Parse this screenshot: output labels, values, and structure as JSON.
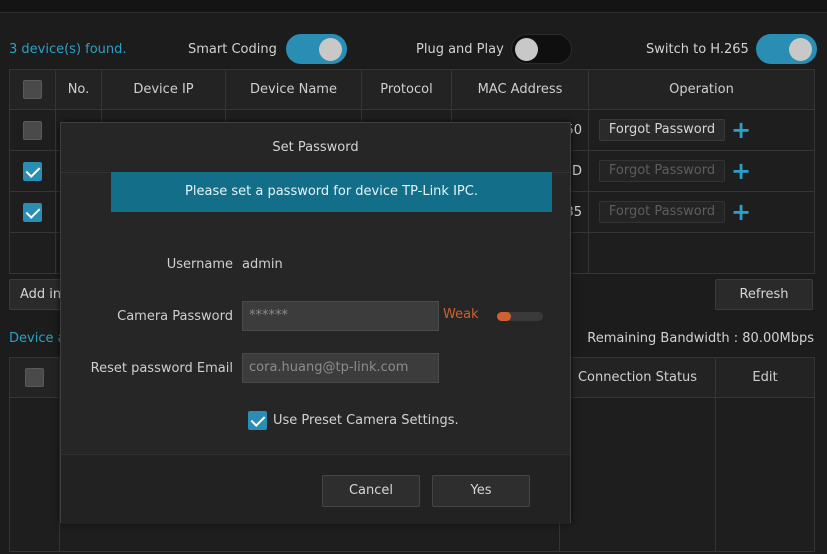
{
  "status": {
    "found_text": "3 device(s) found.",
    "smart_coding": {
      "label": "Smart Coding",
      "on": true
    },
    "plug_and_play": {
      "label": "Plug and Play",
      "on": false
    },
    "switch_h265": {
      "label": "Switch to H.265",
      "on": true
    }
  },
  "device_table": {
    "headers": [
      "No.",
      "Device IP",
      "Device Name",
      "Protocol",
      "MAC Address",
      "Operation"
    ],
    "rows": [
      {
        "checked": false,
        "mac_suffix": "50",
        "operation": "Forgot Password",
        "enabled": true
      },
      {
        "checked": true,
        "mac_suffix": "D",
        "operation": "Forgot Password",
        "enabled": false
      },
      {
        "checked": true,
        "mac_suffix": "35",
        "operation": "Forgot Password",
        "enabled": false
      }
    ]
  },
  "actions": {
    "add_label": "Add in",
    "refresh_label": "Refresh"
  },
  "added_section": {
    "label": "Device a",
    "bandwidth": "Remaining Bandwidth : 80.00Mbps",
    "headers": {
      "connection_status": "Connection Status",
      "edit": "Edit"
    }
  },
  "modal": {
    "title": "Set Password",
    "banner": "Please set a password for device TP-Link IPC.",
    "username_label": "Username",
    "username_value": "admin",
    "password_label": "Camera Password",
    "password_value": "******",
    "strength": "Weak",
    "strength_level": 0.3,
    "email_label": "Reset password Email",
    "email_placeholder": "cora.huang@tp-link.com",
    "preset_label": "Use Preset Camera Settings.",
    "preset_checked": true,
    "cancel_label": "Cancel",
    "yes_label": "Yes"
  },
  "colors": {
    "accent": "#2a8db3",
    "banner": "#136e8a",
    "weak": "#d0602f"
  }
}
